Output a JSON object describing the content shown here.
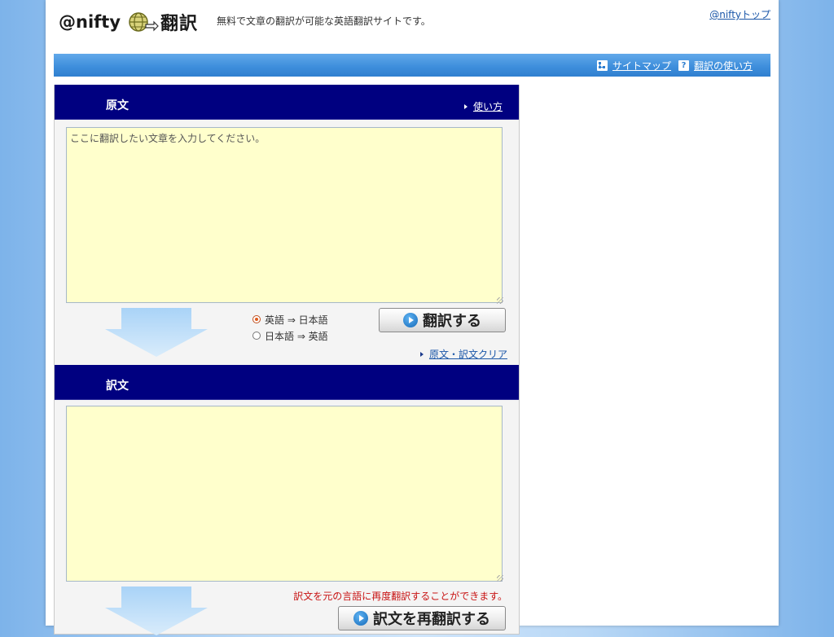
{
  "header": {
    "logo_text": "@nifty",
    "service_name": "翻訳",
    "tagline": "無料で文章の翻訳が可能な英語翻訳サイトです。",
    "top_link": "@niftyトップ"
  },
  "nav": {
    "sitemap": "サイトマップ",
    "usage": "翻訳の使い方"
  },
  "source_panel": {
    "title": "原文",
    "help_link": "使い方",
    "placeholder": "ここに翻訳したい文章を入力してください。",
    "value": "",
    "direction_options": [
      {
        "label": "英語 ⇒ 日本語",
        "selected": true
      },
      {
        "label": "日本語 ⇒ 英語",
        "selected": false
      }
    ],
    "translate_button": "翻訳する",
    "clear_link": "原文・訳文クリア"
  },
  "result_panel": {
    "title": "訳文",
    "value": "",
    "note": "訳文を元の言語に再度翻訳することができます。",
    "retranslate_button": "訳文を再翻訳する"
  },
  "colors": {
    "panel_header": "#000080",
    "textarea_bg": "#ffffcc",
    "nav_bar": "#3f8fdc",
    "note_red": "#c81414",
    "link_blue": "#1a56a8"
  }
}
